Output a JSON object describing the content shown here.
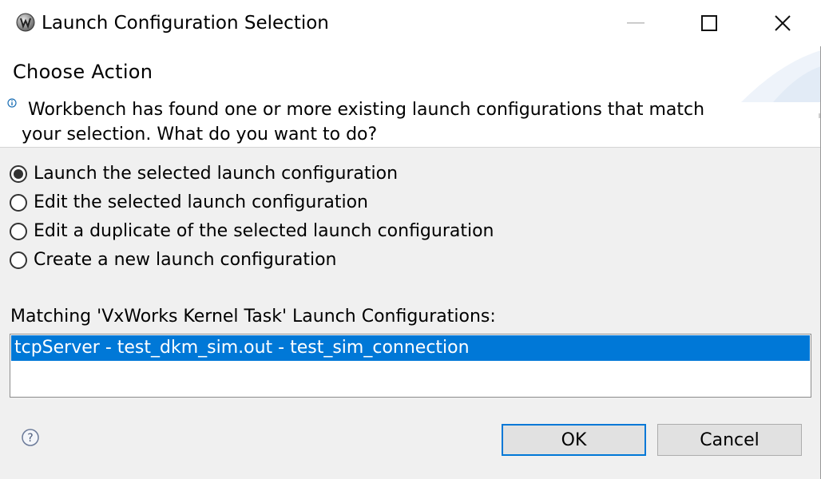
{
  "window": {
    "title": "Launch Configuration Selection",
    "app_icon": "wind-river-workbench-icon",
    "controls": [
      "minimize-icon",
      "maximize-icon",
      "close-icon"
    ]
  },
  "header": {
    "title": "Choose Action",
    "message_line1": "Workbench has found one or more existing launch configurations that match",
    "message_line2": "your selection. What do you want to do?",
    "icon": "info-icon"
  },
  "options": [
    {
      "label": "Launch the selected launch configuration",
      "selected": true
    },
    {
      "label": "Edit the selected launch configuration",
      "selected": false
    },
    {
      "label": "Edit a duplicate of the selected launch configuration",
      "selected": false
    },
    {
      "label": "Create a new launch configuration",
      "selected": false
    }
  ],
  "matching": {
    "label": "Matching 'VxWorks Kernel Task' Launch Configurations:",
    "items": [
      "tcpServer - test_dkm_sim.out - test_sim_connection"
    ],
    "selected_index": 0
  },
  "footer": {
    "help_icon": "help-icon",
    "ok_label": "OK",
    "cancel_label": "Cancel"
  },
  "colors": {
    "selection": "#0078d7",
    "dialog_bg": "#f0f0f0",
    "button_bg": "#e1e1e1"
  }
}
